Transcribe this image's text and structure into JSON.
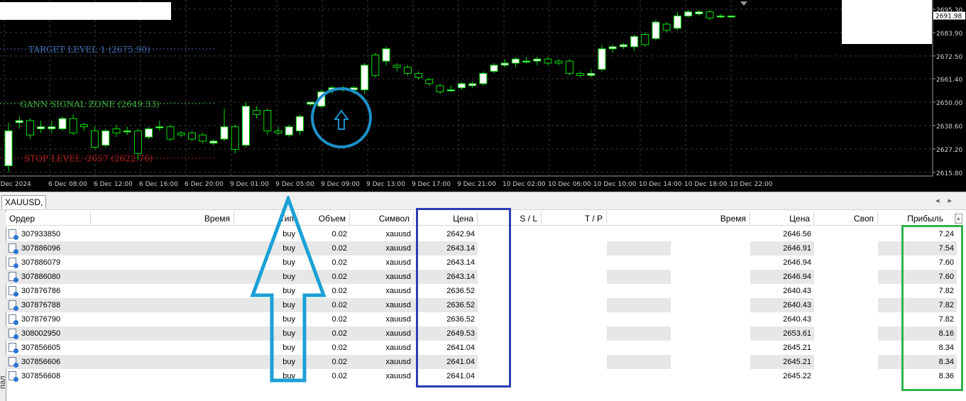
{
  "chart": {
    "price_ticks": [
      "2695.30",
      "2683.90",
      "2672.50",
      "2661.40",
      "2650.00",
      "2638.60",
      "2627.20",
      "2615.80"
    ],
    "current_price": "2691.98",
    "time_ticks": [
      "6 Dec 2024",
      "6 Dec 08:00",
      "6 Dec 12:00",
      "6 Dec 16:00",
      "6 Dec 20:00",
      "9 Dec 01:00",
      "9 Dec 05:00",
      "9 Dec 09:00",
      "9 Dec 13:00",
      "9 Dec 17:00",
      "9 Dec 21:00",
      "10 Dec 02:00",
      "10 Dec 06:00",
      "10 Dec 10:00",
      "10 Dec 14:00",
      "10 Dec 18:00",
      "10 Dec 22:00"
    ],
    "target_label": "TARGET LEVEL 1 (2675.90)",
    "signal_label": "GANN SIGNAL ZONE (2649.33)",
    "stop_label": "STOP LEVEL -2657 (2622.76)",
    "candles": [
      {
        "o": 2619,
        "c": 2636,
        "h": 2640,
        "l": 2616
      },
      {
        "o": 2640,
        "c": 2641,
        "h": 2643,
        "l": 2637
      },
      {
        "o": 2641,
        "c": 2634,
        "h": 2642,
        "l": 2632
      },
      {
        "o": 2637,
        "c": 2638,
        "h": 2641,
        "l": 2635
      },
      {
        "o": 2637,
        "c": 2638,
        "h": 2641,
        "l": 2635
      },
      {
        "o": 2637,
        "c": 2642,
        "h": 2643,
        "l": 2636
      },
      {
        "o": 2642,
        "c": 2635,
        "h": 2644,
        "l": 2634
      },
      {
        "o": 2639,
        "c": 2638,
        "h": 2640,
        "l": 2636
      },
      {
        "o": 2636,
        "c": 2628,
        "h": 2638,
        "l": 2627
      },
      {
        "o": 2629,
        "c": 2636,
        "h": 2637,
        "l": 2628
      },
      {
        "o": 2637,
        "c": 2635,
        "h": 2639,
        "l": 2633
      },
      {
        "o": 2636,
        "c": 2636,
        "h": 2638,
        "l": 2634
      },
      {
        "o": 2636,
        "c": 2625,
        "h": 2637,
        "l": 2622
      },
      {
        "o": 2633,
        "c": 2637,
        "h": 2638,
        "l": 2632
      },
      {
        "o": 2638,
        "c": 2638,
        "h": 2641,
        "l": 2636
      },
      {
        "o": 2638,
        "c": 2632,
        "h": 2639,
        "l": 2631
      },
      {
        "o": 2635,
        "c": 2634,
        "h": 2636,
        "l": 2633
      },
      {
        "o": 2635,
        "c": 2632,
        "h": 2636,
        "l": 2631
      },
      {
        "o": 2634,
        "c": 2631,
        "h": 2635,
        "l": 2630
      },
      {
        "o": 2630,
        "c": 2631,
        "h": 2632,
        "l": 2629
      },
      {
        "o": 2632,
        "c": 2638,
        "h": 2647,
        "l": 2631
      },
      {
        "o": 2638,
        "c": 2627,
        "h": 2639,
        "l": 2625
      },
      {
        "o": 2629,
        "c": 2648,
        "h": 2650,
        "l": 2628
      },
      {
        "o": 2646,
        "c": 2644,
        "h": 2648,
        "l": 2642
      },
      {
        "o": 2646,
        "c": 2636,
        "h": 2647,
        "l": 2634
      },
      {
        "o": 2636,
        "c": 2635,
        "h": 2638,
        "l": 2634
      },
      {
        "o": 2634,
        "c": 2638,
        "h": 2639,
        "l": 2633
      },
      {
        "o": 2636,
        "c": 2643,
        "h": 2644,
        "l": 2634
      },
      {
        "o": 2649,
        "c": 2650,
        "h": 2650,
        "l": 2648
      },
      {
        "o": 2648,
        "c": 2655,
        "h": 2656,
        "l": 2647
      },
      {
        "o": 2656,
        "c": 2657,
        "h": 2658,
        "l": 2654
      },
      {
        "o": 2656,
        "c": 2657,
        "h": 2658,
        "l": 2655
      },
      {
        "o": 2656,
        "c": 2657,
        "h": 2658,
        "l": 2654
      },
      {
        "o": 2656,
        "c": 2668,
        "h": 2669,
        "l": 2654
      },
      {
        "o": 2673,
        "c": 2663,
        "h": 2674,
        "l": 2662
      },
      {
        "o": 2670,
        "c": 2676,
        "h": 2677,
        "l": 2668
      },
      {
        "o": 2668,
        "c": 2667,
        "h": 2669,
        "l": 2665
      },
      {
        "o": 2667,
        "c": 2664,
        "h": 2668,
        "l": 2663
      },
      {
        "o": 2664,
        "c": 2662,
        "h": 2665,
        "l": 2661
      },
      {
        "o": 2661,
        "c": 2659,
        "h": 2662,
        "l": 2658
      },
      {
        "o": 2658,
        "c": 2655,
        "h": 2659,
        "l": 2654
      },
      {
        "o": 2656,
        "c": 2656,
        "h": 2658,
        "l": 2655
      },
      {
        "o": 2657,
        "c": 2659,
        "h": 2660,
        "l": 2656
      },
      {
        "o": 2658,
        "c": 2659,
        "h": 2660,
        "l": 2657
      },
      {
        "o": 2659,
        "c": 2664,
        "h": 2665,
        "l": 2658
      },
      {
        "o": 2665,
        "c": 2668,
        "h": 2669,
        "l": 2664
      },
      {
        "o": 2668,
        "c": 2669,
        "h": 2671,
        "l": 2667
      },
      {
        "o": 2669,
        "c": 2671,
        "h": 2672,
        "l": 2667
      },
      {
        "o": 2670,
        "c": 2670,
        "h": 2672,
        "l": 2669
      },
      {
        "o": 2670,
        "c": 2671,
        "h": 2672,
        "l": 2668
      },
      {
        "o": 2671,
        "c": 2669,
        "h": 2672,
        "l": 2668
      },
      {
        "o": 2670,
        "c": 2669,
        "h": 2671,
        "l": 2668
      },
      {
        "o": 2670,
        "c": 2664,
        "h": 2671,
        "l": 2663
      },
      {
        "o": 2664,
        "c": 2663,
        "h": 2665,
        "l": 2662
      },
      {
        "o": 2663,
        "c": 2664,
        "h": 2666,
        "l": 2662
      },
      {
        "o": 2666,
        "c": 2676,
        "h": 2678,
        "l": 2665
      },
      {
        "o": 2676,
        "c": 2677,
        "h": 2678,
        "l": 2674
      },
      {
        "o": 2677,
        "c": 2678,
        "h": 2679,
        "l": 2676
      },
      {
        "o": 2677,
        "c": 2682,
        "h": 2683,
        "l": 2675
      },
      {
        "o": 2683,
        "c": 2678,
        "h": 2684,
        "l": 2677
      },
      {
        "o": 2681,
        "c": 2689,
        "h": 2690,
        "l": 2680
      },
      {
        "o": 2688,
        "c": 2685,
        "h": 2689,
        "l": 2684
      },
      {
        "o": 2686,
        "c": 2692,
        "h": 2694,
        "l": 2685
      },
      {
        "o": 2692,
        "c": 2694,
        "h": 2695,
        "l": 2691
      },
      {
        "o": 2693,
        "c": 2694,
        "h": 2695,
        "l": 2692
      },
      {
        "o": 2694,
        "c": 2691,
        "h": 2695,
        "l": 2690
      },
      {
        "o": 2692,
        "c": 2692,
        "h": 2693,
        "l": 2691
      },
      {
        "o": 2692,
        "c": 2692,
        "h": 2692,
        "l": 2691
      }
    ]
  },
  "tab_symbol": "XAUUSD,",
  "side_label": "пал",
  "headers": [
    "Ордер",
    "Время",
    "Тип",
    "Объем",
    "Символ",
    "Цена",
    "S / L",
    "T / P",
    "Время",
    "Цена",
    "Своп",
    "Прибыль"
  ],
  "sort_indicator": "/",
  "rows": [
    {
      "order": "307933850",
      "type": "buy",
      "volume": "0.02",
      "symbol": "xauusd",
      "price": "2642.94",
      "close_price": "2646.56",
      "profit": "7.24"
    },
    {
      "order": "307886096",
      "type": "buy",
      "volume": "0.02",
      "symbol": "xauusd",
      "price": "2643.14",
      "close_price": "2646.91",
      "profit": "7.54"
    },
    {
      "order": "307886079",
      "type": "buy",
      "volume": "0.02",
      "symbol": "xauusd",
      "price": "2643.14",
      "close_price": "2646.94",
      "profit": "7.60"
    },
    {
      "order": "307886080",
      "type": "buy",
      "volume": "0.02",
      "symbol": "xauusd",
      "price": "2643.14",
      "close_price": "2646.94",
      "profit": "7.60"
    },
    {
      "order": "307876786",
      "type": "buy",
      "volume": "0.02",
      "symbol": "xauusd",
      "price": "2636.52",
      "close_price": "2640.43",
      "profit": "7.82"
    },
    {
      "order": "307876788",
      "type": "buy",
      "volume": "0.02",
      "symbol": "xauusd",
      "price": "2636.52",
      "close_price": "2640.43",
      "profit": "7.82"
    },
    {
      "order": "307876790",
      "type": "buy",
      "volume": "0.02",
      "symbol": "xauusd",
      "price": "2636.52",
      "close_price": "2640.43",
      "profit": "7.82"
    },
    {
      "order": "308002950",
      "type": "buy",
      "volume": "0.02",
      "symbol": "xauusd",
      "price": "2649.53",
      "close_price": "2653.61",
      "profit": "8.16"
    },
    {
      "order": "307856605",
      "type": "buy",
      "volume": "0.02",
      "symbol": "xauusd",
      "price": "2641.04",
      "close_price": "2645.21",
      "profit": "8.34"
    },
    {
      "order": "307856606",
      "type": "buy",
      "volume": "0.02",
      "symbol": "xauusd",
      "price": "2641.04",
      "close_price": "2645.21",
      "profit": "8.34"
    },
    {
      "order": "307856608",
      "type": "buy",
      "volume": "0.02",
      "symbol": "xauusd",
      "price": "2641.04",
      "close_price": "2645.22",
      "profit": "8.36"
    }
  ],
  "colors": {
    "bull_candle": "#ffffff",
    "bear_candle": "#000000",
    "candle_outline": "#00e000",
    "target_text": "#3f6fb0",
    "signal_text": "#3fae3f",
    "stop_text": "#b02020",
    "circle": "#1e90c8",
    "arrow": "#1aa0d6",
    "price_box": "#2b3db4",
    "profit_box": "#2fb34a"
  }
}
